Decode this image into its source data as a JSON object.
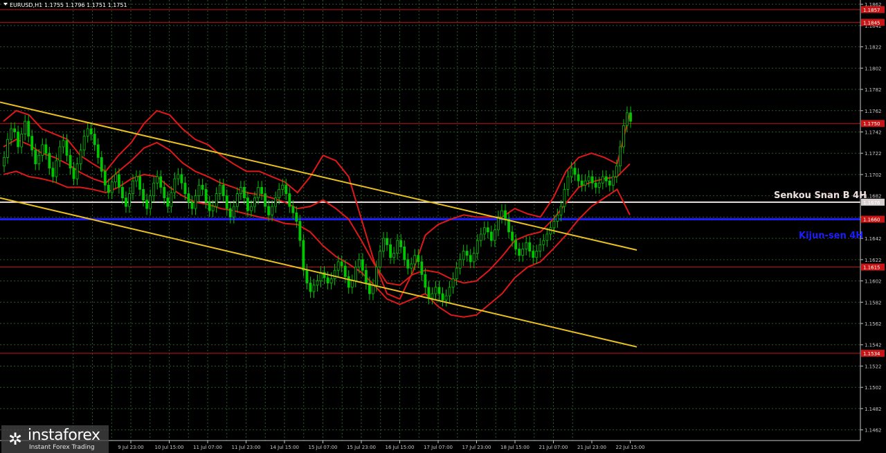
{
  "header": {
    "symbol_label": "EURUSD,H1",
    "ohlc": "1.1755 1.1796 1.1751 1.1751"
  },
  "overlays": {
    "senkou_span_b": "Senkou Snan B 4H",
    "kijun_sen": "Kijun-sen 4H"
  },
  "logo": {
    "name": "instaforex",
    "slogan": "Instant Forex Trading"
  },
  "colors": {
    "background": "#000000",
    "grid": "#2c5a2c",
    "bull_candle": "#00c800",
    "bear_candle": "#00c800",
    "bollinger": "#e01818",
    "channel": "#e8c020",
    "support_resistance": "#c81414",
    "senkou_span_b": "#f0e0e0",
    "kijun_sen": "#1c1cff"
  },
  "chart_data": {
    "type": "candlestick",
    "symbol": "EURUSD",
    "timeframe": "H1",
    "ylim": [
      1.1452,
      1.1866
    ],
    "y_ticks": [
      "1.1862",
      "1.1842",
      "1.1822",
      "1.1802",
      "1.1782",
      "1.1762",
      "1.1742",
      "1.1722",
      "1.1702",
      "1.1682",
      "1.1662",
      "1.1642",
      "1.1622",
      "1.1602",
      "1.1582",
      "1.1562",
      "1.1542",
      "1.1522",
      "1.1502",
      "1.1482",
      "1.1462"
    ],
    "x_ticks": [
      "9 Jul 23:00",
      "10 Jul 15:00",
      "11 Jul 07:00",
      "11 Jul 23:00",
      "14 Jul 15:00",
      "15 Jul 07:00",
      "15 Jul 23:00",
      "16 Jul 15:00",
      "17 Jul 07:00",
      "17 Jul 23:00",
      "18 Jul 15:00",
      "21 Jul 07:00",
      "21 Jul 23:00",
      "22 Jul 15:00"
    ],
    "price_levels": [
      {
        "label": "1.1857",
        "value": 1.1857,
        "kind": "support_resistance"
      },
      {
        "label": "1.1845",
        "value": 1.1845,
        "kind": "support_resistance"
      },
      {
        "label": "1.1750",
        "value": 1.175,
        "kind": "support_resistance"
      },
      {
        "label": "1.1676",
        "value": 1.1676,
        "kind": "senkou_span_b"
      },
      {
        "label": "1.1660",
        "value": 1.166,
        "kind": "kijun_sen"
      },
      {
        "label": "1.1615",
        "value": 1.1615,
        "kind": "support_resistance"
      },
      {
        "label": "1.1534",
        "value": 1.1534,
        "kind": "support_resistance"
      }
    ],
    "trend_channel": [
      {
        "name": "upper",
        "from": [
          0,
          1.177
        ],
        "to": [
          250,
          1.1631
        ]
      },
      {
        "name": "lower",
        "from": [
          0,
          1.168
        ],
        "to": [
          250,
          1.154
        ]
      }
    ],
    "bollinger": {
      "upper": [
        1.1752,
        1.1762,
        1.1758,
        1.1745,
        1.174,
        1.1735,
        1.172,
        1.1712,
        1.1705,
        1.172,
        1.1732,
        1.175,
        1.1762,
        1.1758,
        1.1745,
        1.1735,
        1.173,
        1.172,
        1.1712,
        1.1705,
        1.1705,
        1.17,
        1.1695,
        1.1685,
        1.17,
        1.172,
        1.1715,
        1.17,
        1.166,
        1.162,
        1.159,
        1.1585,
        1.161,
        1.1645,
        1.1655,
        1.166,
        1.1664,
        1.1662,
        1.1662,
        1.1662,
        1.167,
        1.1665,
        1.1662,
        1.168,
        1.1705,
        1.1718,
        1.1722,
        1.1718,
        1.1712,
        1.176
      ],
      "middle": [
        1.1728,
        1.1735,
        1.173,
        1.1722,
        1.1718,
        1.1712,
        1.1704,
        1.1698,
        1.1694,
        1.1705,
        1.1715,
        1.1727,
        1.1732,
        1.1725,
        1.1713,
        1.1705,
        1.17,
        1.1694,
        1.169,
        1.1685,
        1.1683,
        1.168,
        1.1676,
        1.167,
        1.1672,
        1.1678,
        1.167,
        1.166,
        1.164,
        1.1618,
        1.16,
        1.1598,
        1.1608,
        1.1612,
        1.161,
        1.1604,
        1.16,
        1.1602,
        1.1612,
        1.1625,
        1.164,
        1.1645,
        1.1648,
        1.166,
        1.1675,
        1.169,
        1.1695,
        1.1698,
        1.17,
        1.1712
      ],
      "lower": [
        1.1702,
        1.1705,
        1.17,
        1.1698,
        1.1695,
        1.169,
        1.169,
        1.1688,
        1.1685,
        1.169,
        1.1698,
        1.1702,
        1.17,
        1.169,
        1.1682,
        1.1676,
        1.1674,
        1.167,
        1.1668,
        1.1665,
        1.1662,
        1.166,
        1.1656,
        1.1655,
        1.1648,
        1.1635,
        1.1625,
        1.1618,
        1.161,
        1.1598,
        1.1585,
        1.158,
        1.1585,
        1.159,
        1.1578,
        1.157,
        1.1568,
        1.157,
        1.158,
        1.159,
        1.1605,
        1.1615,
        1.162,
        1.1632,
        1.1645,
        1.166,
        1.1672,
        1.168,
        1.1688,
        1.1664
      ]
    },
    "candles_close": [
      1.1718,
      1.1735,
      1.1745,
      1.1742,
      1.1728,
      1.174,
      1.1752,
      1.1738,
      1.1725,
      1.1712,
      1.172,
      1.173,
      1.1722,
      1.1708,
      1.17,
      1.1715,
      1.1728,
      1.1734,
      1.172,
      1.1708,
      1.1698,
      1.1712,
      1.1725,
      1.1738,
      1.1745,
      1.174,
      1.173,
      1.1718,
      1.1705,
      1.1692,
      1.1685,
      1.1695,
      1.1702,
      1.169,
      1.168,
      1.1672,
      1.1684,
      1.1696,
      1.17,
      1.1688,
      1.1678,
      1.167,
      1.1682,
      1.1694,
      1.17,
      1.169,
      1.168,
      1.1672,
      1.1685,
      1.1698,
      1.1702,
      1.1694,
      1.1684,
      1.1676,
      1.167,
      1.1682,
      1.1692,
      1.1688,
      1.1676,
      1.1668,
      1.1672,
      1.1684,
      1.1692,
      1.1682,
      1.167,
      1.1662,
      1.1672,
      1.1684,
      1.169,
      1.168,
      1.1668,
      1.1672,
      1.168,
      1.169,
      1.1684,
      1.1672,
      1.1664,
      1.1672,
      1.168,
      1.1688,
      1.1692,
      1.1684,
      1.1672,
      1.1666,
      1.1658,
      1.164,
      1.1612,
      1.16,
      1.1592,
      1.1598,
      1.1602,
      1.161,
      1.1605,
      1.16,
      1.1604,
      1.1612,
      1.162,
      1.1616,
      1.1606,
      1.1596,
      1.1602,
      1.1615,
      1.1622,
      1.1612,
      1.16,
      1.159,
      1.1598,
      1.1615,
      1.163,
      1.1642,
      1.1636,
      1.1624,
      1.1628,
      1.164,
      1.1634,
      1.1622,
      1.1614,
      1.1618,
      1.1626,
      1.162,
      1.1608,
      1.1596,
      1.1586,
      1.159,
      1.1596,
      1.159,
      1.1584,
      1.1588,
      1.1596,
      1.1604,
      1.1614,
      1.1622,
      1.163,
      1.1626,
      1.162,
      1.1628,
      1.164,
      1.1646,
      1.1652,
      1.1648,
      1.164,
      1.165,
      1.1662,
      1.1668,
      1.166,
      1.1648,
      1.164,
      1.1632,
      1.1626,
      1.1632,
      1.1638,
      1.163,
      1.1624,
      1.163,
      1.1636,
      1.164,
      1.1646,
      1.1652,
      1.1658,
      1.1664,
      1.1672,
      1.1688,
      1.17,
      1.1708,
      1.1702,
      1.1696,
      1.1692,
      1.1696,
      1.17,
      1.1694,
      1.169,
      1.1694,
      1.17,
      1.1696,
      1.1692,
      1.17,
      1.171,
      1.1728,
      1.1748,
      1.176,
      1.1752
    ]
  }
}
